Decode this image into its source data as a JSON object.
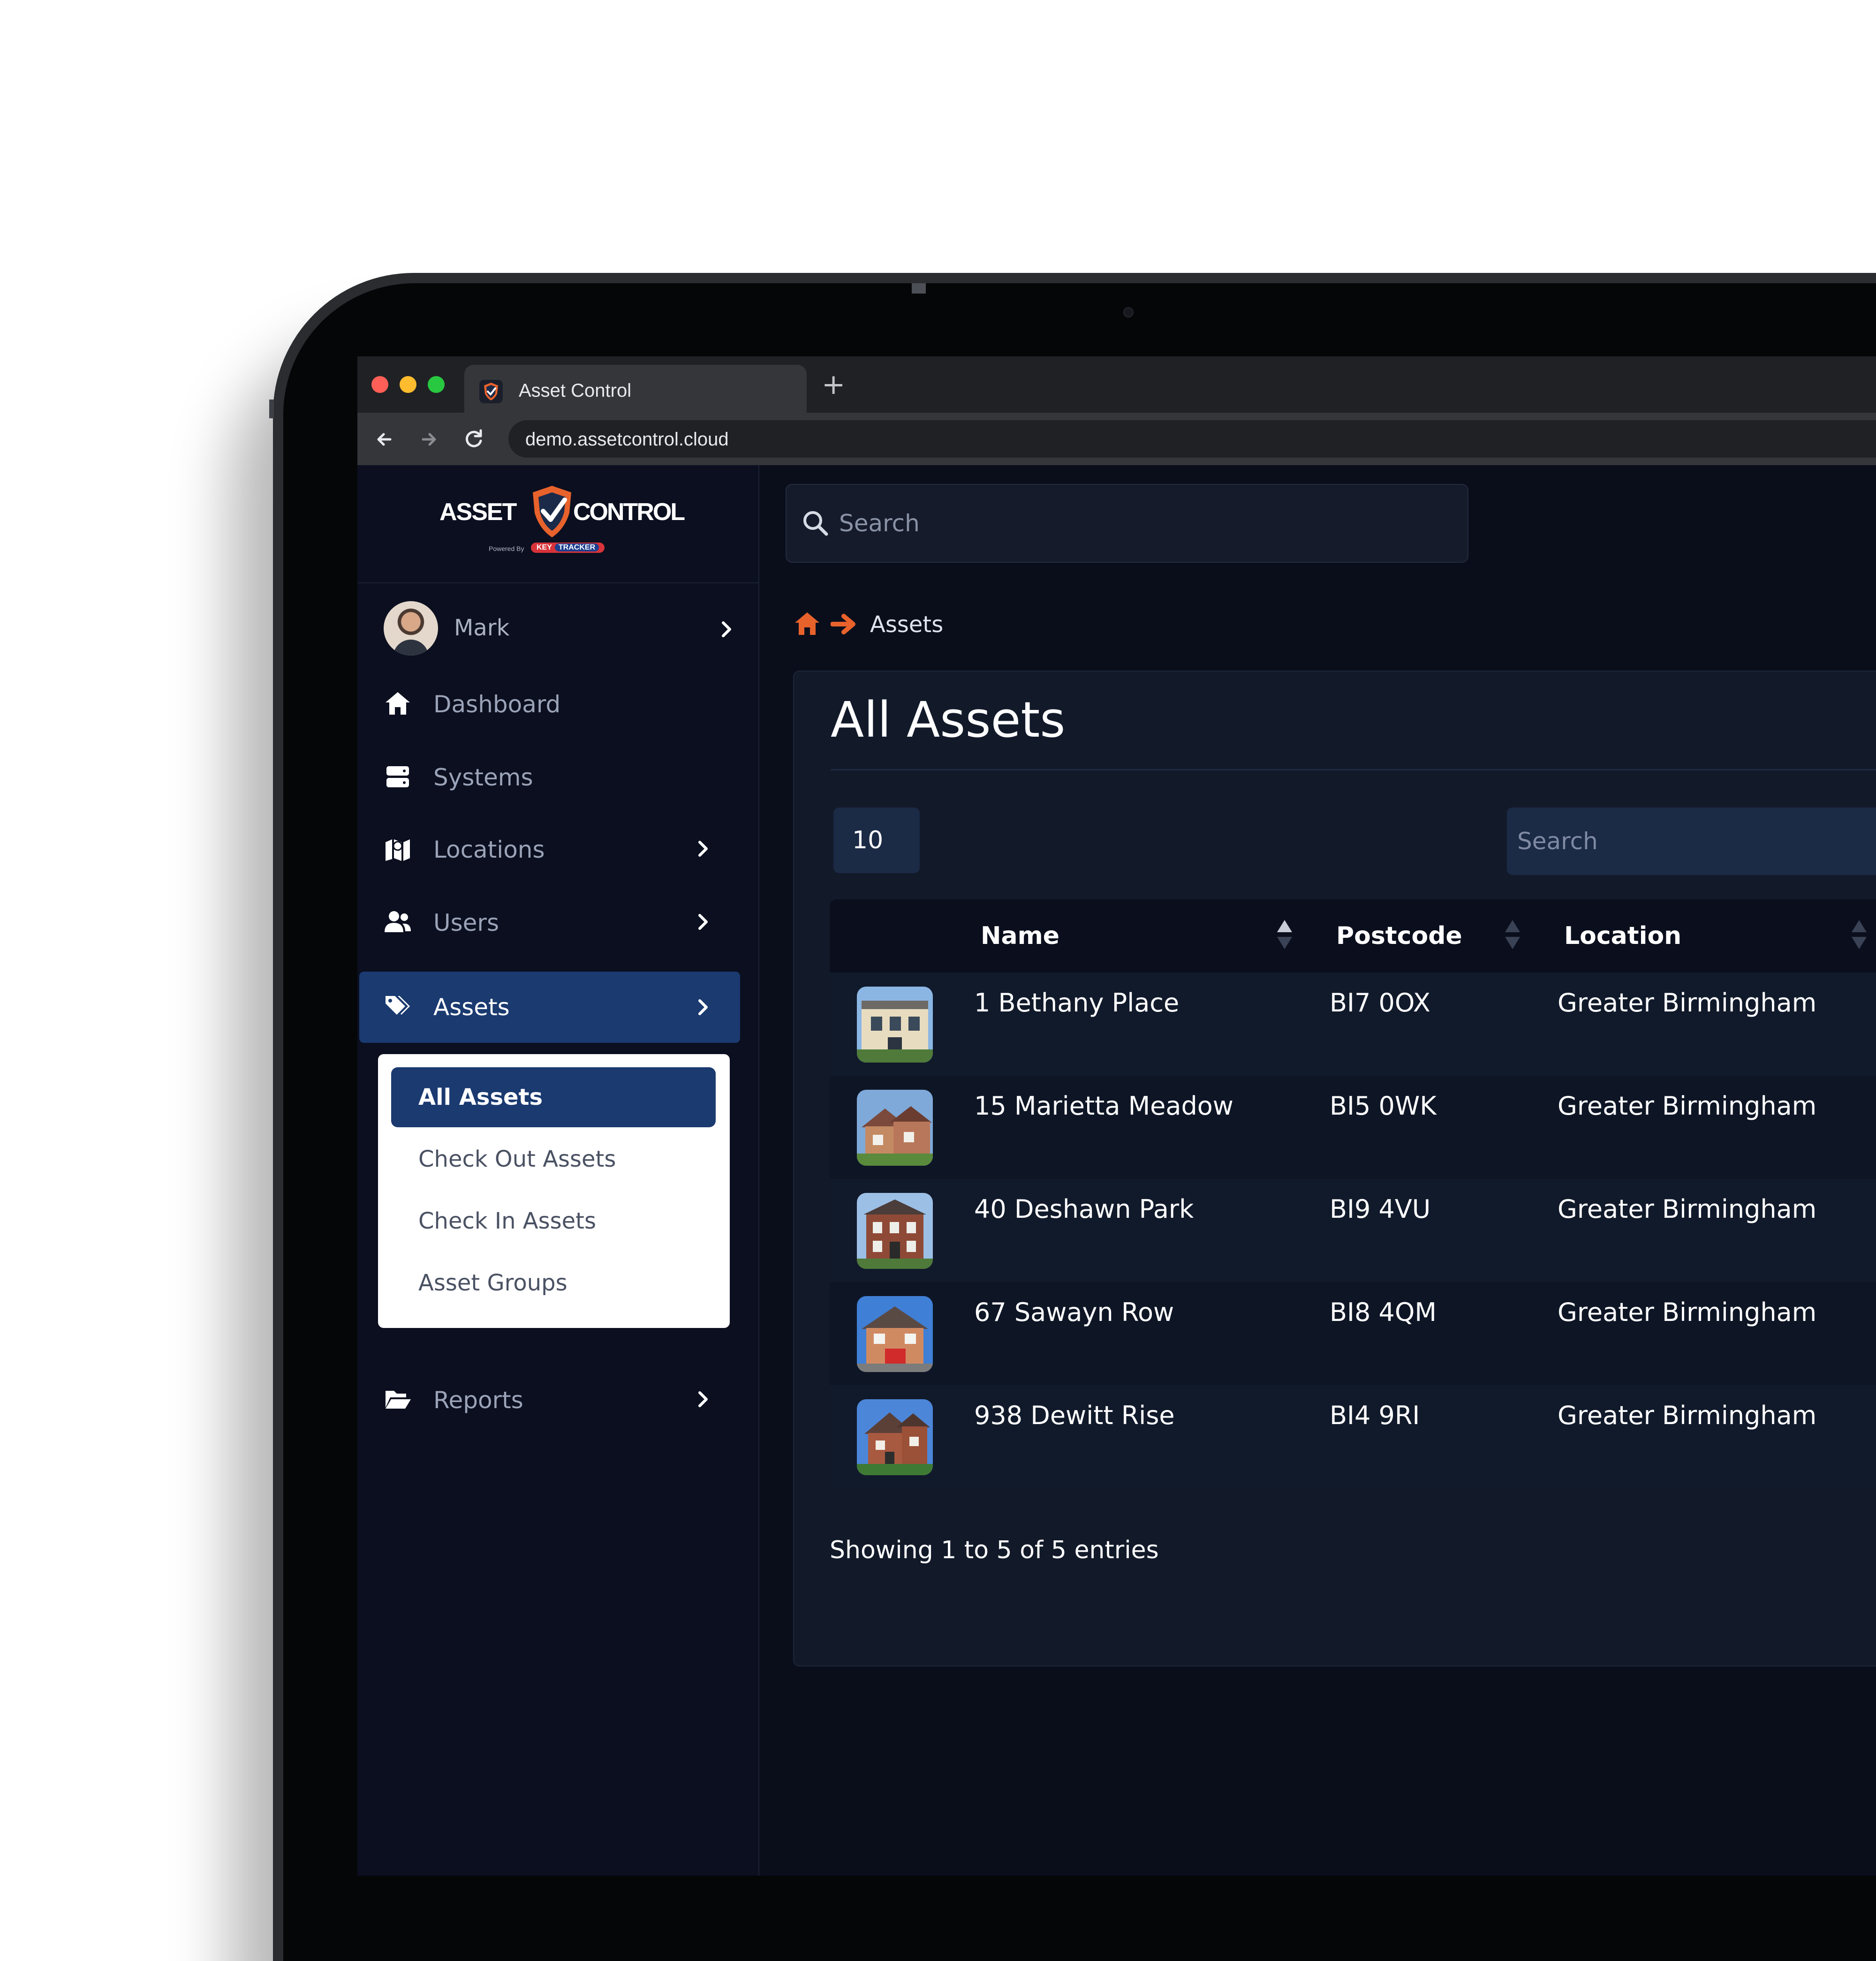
{
  "browser": {
    "tab_title": "Asset Control",
    "new_tab": "+",
    "url": "demo.assetcontrol.cloud"
  },
  "logo": {
    "left": "ASSET",
    "right": "CONTROL",
    "powered": "Powered By",
    "key": "KEY",
    "tracker": "TRACKER"
  },
  "user": {
    "name": "Mark"
  },
  "sidebar": {
    "items": [
      {
        "label": "Dashboard",
        "icon": "home-icon",
        "has_arrow": false
      },
      {
        "label": "Systems",
        "icon": "server-icon",
        "has_arrow": false
      },
      {
        "label": "Locations",
        "icon": "map-icon",
        "has_arrow": true
      },
      {
        "label": "Users",
        "icon": "users-icon",
        "has_arrow": true
      },
      {
        "label": "Assets",
        "icon": "tags-icon",
        "has_arrow": true,
        "active": true
      },
      {
        "label": "Reports",
        "icon": "folder-open-icon",
        "has_arrow": true
      }
    ],
    "submenu": [
      {
        "label": "All Assets",
        "active": true
      },
      {
        "label": "Check Out Assets"
      },
      {
        "label": "Check In Assets"
      },
      {
        "label": "Asset Groups"
      }
    ]
  },
  "header": {
    "search_placeholder": "Search"
  },
  "breadcrumb": {
    "current": "Assets"
  },
  "main": {
    "title": "All Assets",
    "page_size": "10",
    "search_placeholder": "Search",
    "columns": [
      "Name",
      "Postcode",
      "Location"
    ],
    "rows": [
      {
        "name": "1 Bethany Place",
        "postcode": "BI7 0OX",
        "location": "Greater Birmingham"
      },
      {
        "name": "15 Marietta Meadow",
        "postcode": "BI5 0WK",
        "location": "Greater Birmingham"
      },
      {
        "name": "40 Deshawn Park",
        "postcode": "BI9 4VU",
        "location": "Greater Birmingham"
      },
      {
        "name": "67 Sawayn Row",
        "postcode": "BI8 4QM",
        "location": "Greater Birmingham"
      },
      {
        "name": "938 Dewitt Rise",
        "postcode": "BI4 9RI",
        "location": "Greater Birmingham"
      }
    ],
    "footer": "Showing 1 to 5 of 5 entries"
  },
  "colors": {
    "accent": "#1a3a70",
    "brand_orange": "#e8622c",
    "background": "#0a0e1b"
  }
}
